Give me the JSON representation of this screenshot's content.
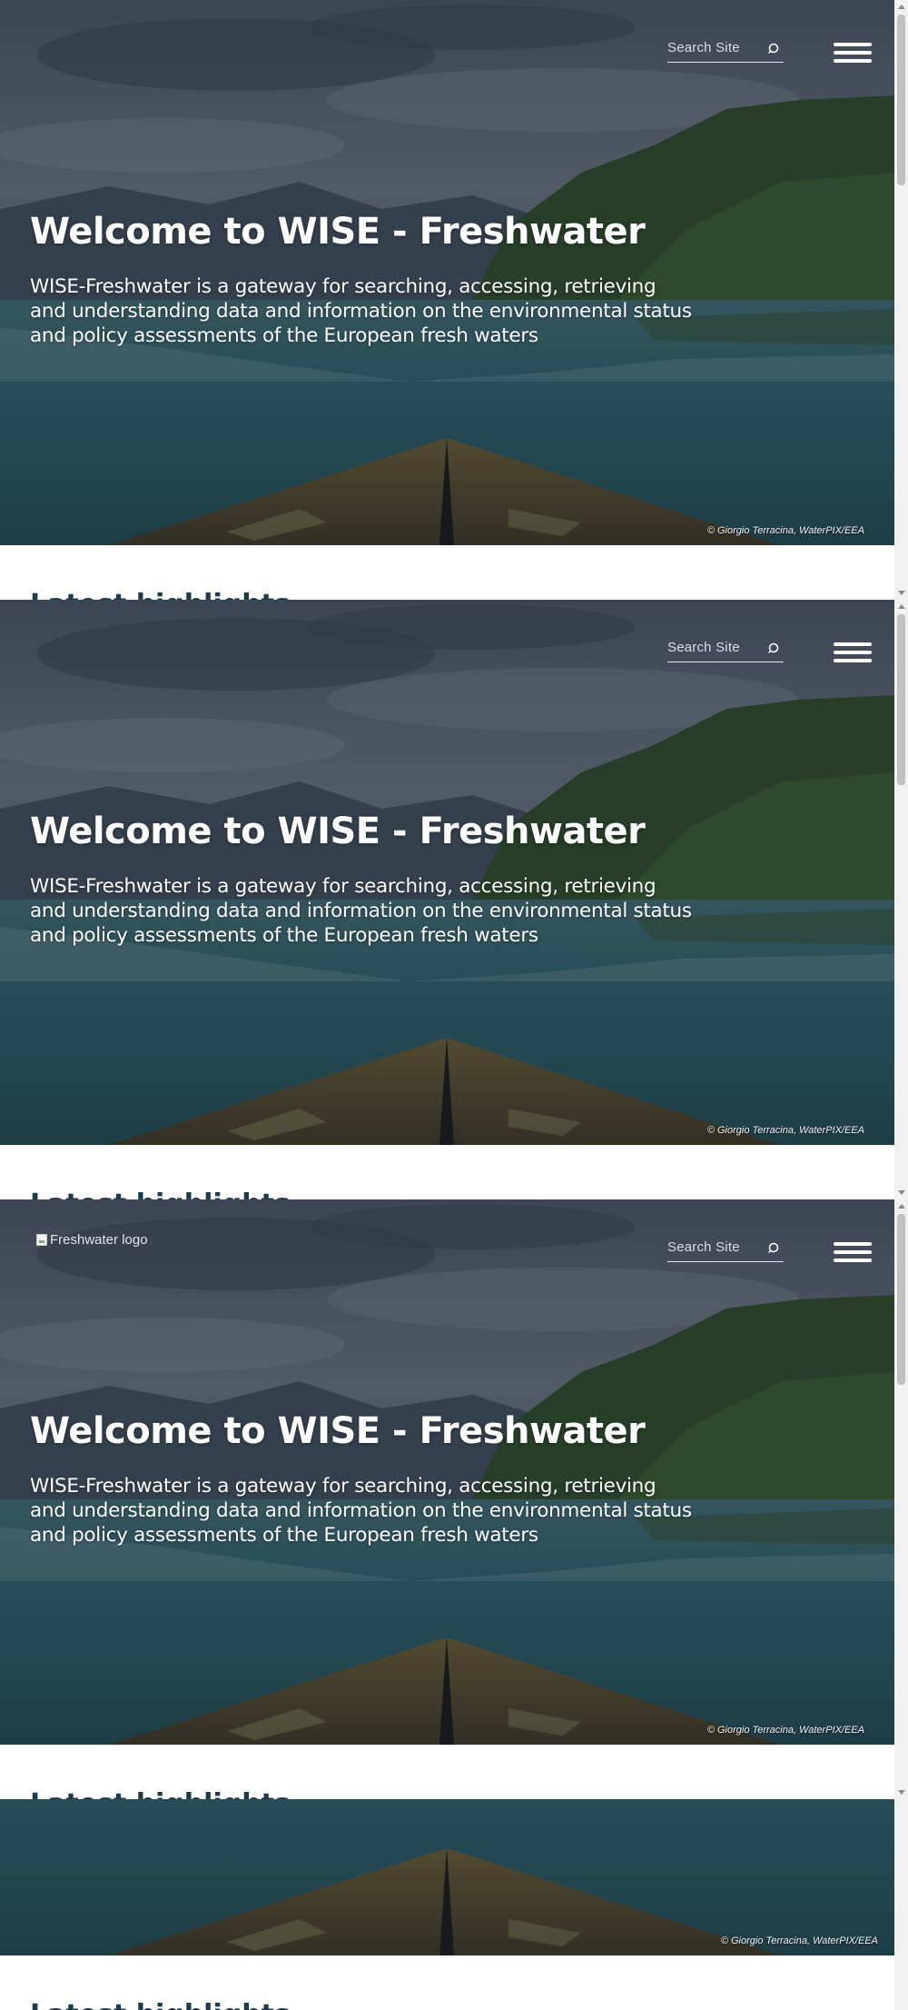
{
  "header": {
    "search_placeholder": "Search Site",
    "logo_alt": "Freshwater logo"
  },
  "hero": {
    "title": "Welcome to WISE - Freshwater",
    "description": "WISE-Freshwater is a gateway for searching, accessing, retrieving and understanding data and information on the environmental status and policy assessments of the European fresh waters",
    "credit": "© Giorgio Terracina, WaterPIX/EEA"
  },
  "section": {
    "peek_heading": "Latest highlights"
  },
  "colors": {
    "heading_dark": "#1e3a4a",
    "overlay": "#2b3440",
    "water": "#2a5c66",
    "forest": "#2d4a22",
    "rock": "#5a5030"
  },
  "icons": {
    "search": "search-icon",
    "menu": "hamburger-menu-icon"
  }
}
